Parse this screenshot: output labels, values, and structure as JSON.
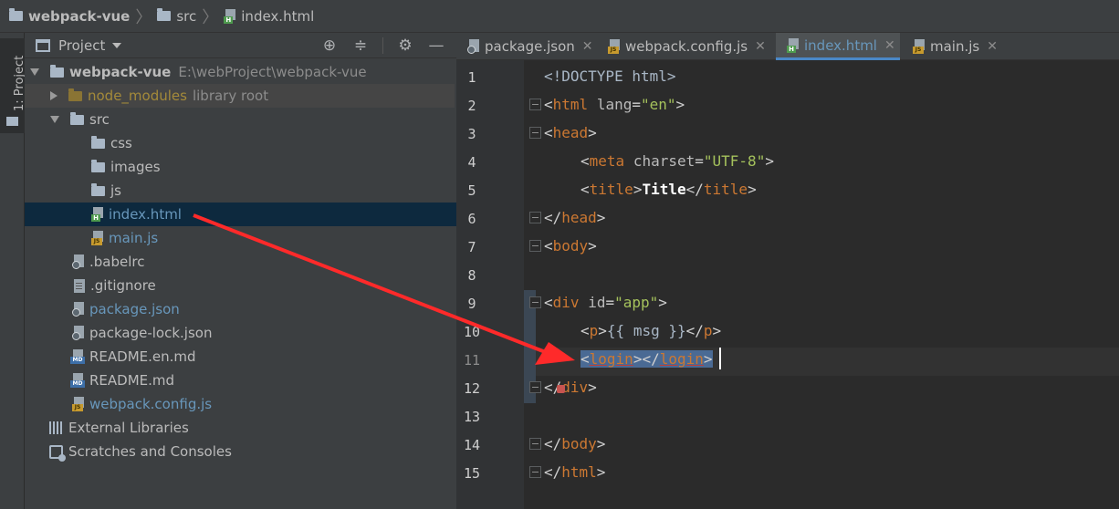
{
  "breadcrumb": [
    "webpack-vue",
    "src",
    "index.html"
  ],
  "toolstrip": {
    "project_tab": "1: Project"
  },
  "project_panel": {
    "title": "Project",
    "root": {
      "name": "webpack-vue",
      "path": "E:\\webProject\\webpack-vue"
    },
    "node_modules": {
      "name": "node_modules",
      "suffix": "library root"
    },
    "src": "src",
    "css": "css",
    "images": "images",
    "js": "js",
    "index_html": "index.html",
    "main_js": "main.js",
    "babelrc": ".babelrc",
    "gitignore": ".gitignore",
    "package_json": "package.json",
    "package_lock": "package-lock.json",
    "readme_en": "README.en.md",
    "readme": "README.md",
    "webpack_config": "webpack.config.js",
    "external_libraries": "External Libraries",
    "scratches": "Scratches and Consoles"
  },
  "editor_tabs": [
    "package.json",
    "webpack.config.js",
    "index.html",
    "main.js"
  ],
  "line_numbers": [
    "1",
    "2",
    "3",
    "4",
    "5",
    "6",
    "7",
    "8",
    "9",
    "10",
    "11",
    "12",
    "13",
    "14",
    "15"
  ],
  "code": {
    "doctype": "<!DOCTYPE html>",
    "html_open": "html",
    "lang_attr": "lang",
    "lang_val": "\"en\"",
    "head": "head",
    "meta": "meta",
    "charset_attr": "charset",
    "charset_val": "\"UTF-8\"",
    "title": "title",
    "title_text": "Title",
    "body": "body",
    "div": "div",
    "id_attr": "id",
    "id_val": "\"app\"",
    "p": "p",
    "mustache": "{{ msg }}",
    "login": "login",
    "html_close": "html"
  },
  "colors": {
    "accent": "#4a88c7",
    "arrow": "#ff2a2a"
  }
}
